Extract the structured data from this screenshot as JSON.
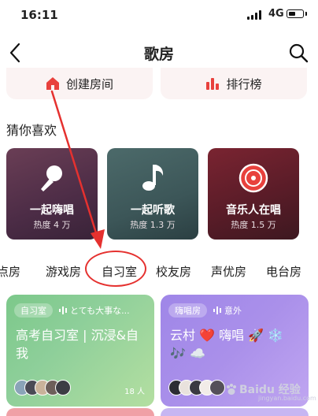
{
  "status": {
    "time": "16:11",
    "network": "4G"
  },
  "nav": {
    "title": "歌房"
  },
  "actions": [
    {
      "label": "创建房间",
      "color": "#e8413d"
    },
    {
      "label": "排行榜",
      "color": "#e8413d"
    }
  ],
  "section_title": "猜你喜欢",
  "recommend": [
    {
      "title": "一起嗨唱",
      "sub": "热度 4 万",
      "icon": "microphone-icon"
    },
    {
      "title": "一起听歌",
      "sub": "热度 1.3 万",
      "icon": "music-note-icon"
    },
    {
      "title": "音乐人在唱",
      "sub": "热度 1.5 万",
      "icon": "vinyl-icon"
    }
  ],
  "tabs": [
    "点房",
    "游戏房",
    "自习室",
    "校友房",
    "声优房",
    "电台房"
  ],
  "rooms": [
    {
      "badge": "自习室",
      "sub": "とても大事な...",
      "title": "高考自习室 | 沉浸&自我",
      "count": "18 人"
    },
    {
      "badge": "嗨唱房",
      "sub": "意外",
      "title": "云村 ❤️ 嗨唱 🚀 ❄️ 🎶 ☁️",
      "count": ""
    }
  ],
  "watermark": {
    "text": "Baidu 经验",
    "site": "jingyan.baidu.com"
  },
  "colors": {
    "accent": "#e8413d",
    "annotation": "#e5312f"
  }
}
